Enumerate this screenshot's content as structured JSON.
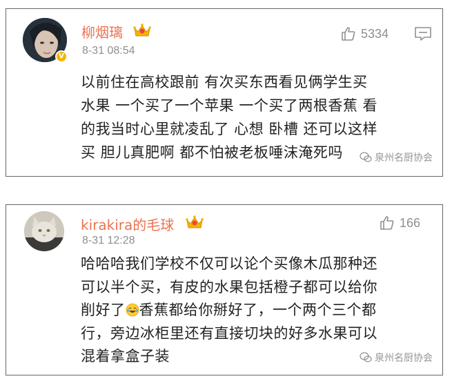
{
  "comments": [
    {
      "username": "柳烟璃",
      "time": "8-31 08:54",
      "likes": "5334",
      "lines": [
        "以前住在高校跟前 有次买东西看见俩学生买",
        "水果 一个买了一个苹果 一个买了两根香蕉 看",
        "的我当时心里就凌乱了 心想 卧槽 还可以这样",
        "买 胆儿真肥啊 都不怕被老板唾沫淹死吗"
      ],
      "watermark": "泉州名厨协会",
      "verified_badge": "V"
    },
    {
      "username": "kirakira的毛球",
      "time": "8-31 12:28",
      "likes": "166",
      "lines": [
        "哈哈哈我们学校不仅可以论个买像木瓜那种还",
        "可以半个买，有皮的水果包括橙子都可以给你",
        "削好了",
        "香蕉都给你掰好了，一个两个三个都",
        "行，旁边冰柜里还有直接切块的好多水果可以",
        "混着拿盒子装"
      ],
      "watermark": "泉州名厨协会"
    }
  ],
  "colors": {
    "username": "#eb7350",
    "meta": "#8f8f8f",
    "text": "#222222"
  },
  "icons": [
    "thumbs-up-icon",
    "reply-icon",
    "crown-badge-icon",
    "verified-badge-icon",
    "laugh-cry-emoji",
    "wechat-icon"
  ]
}
